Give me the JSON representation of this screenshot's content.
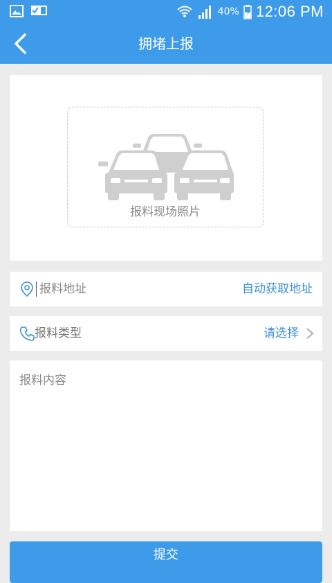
{
  "status_bar": {
    "battery_percent": "40%",
    "time": "12:06 PM"
  },
  "header": {
    "title": "拥堵上报"
  },
  "photo": {
    "label": "报料现场照片"
  },
  "address": {
    "placeholder": "报料地址",
    "action": "自动获取地址"
  },
  "type": {
    "label": "报料类型",
    "action": "请选择"
  },
  "content": {
    "placeholder": "报料内容"
  },
  "submit": {
    "label": "提交"
  },
  "colors": {
    "primary": "#3d9be9",
    "link": "#3d8fd6",
    "background": "#ececec"
  }
}
